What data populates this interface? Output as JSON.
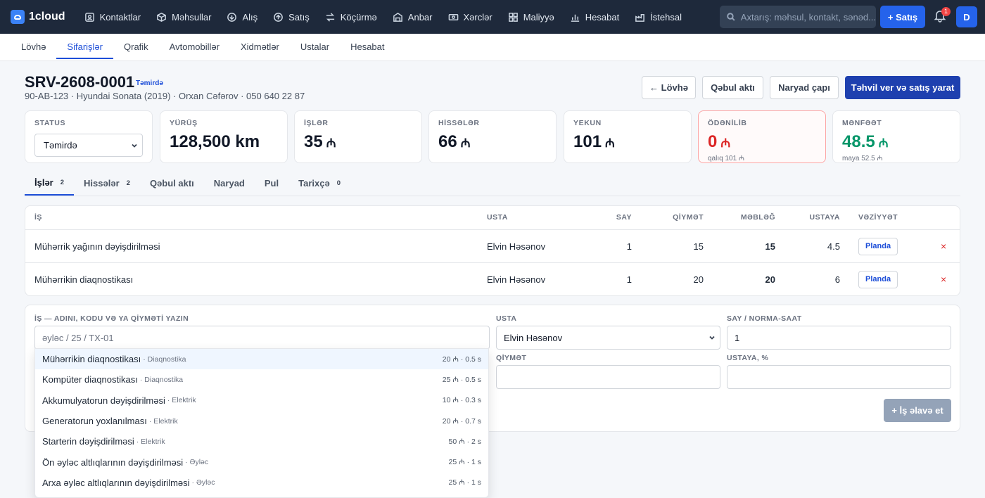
{
  "app": {
    "logo": "1cloud"
  },
  "nav": [
    {
      "label": "Kontaktlar",
      "icon": "contacts-icon"
    },
    {
      "label": "Məhsullar",
      "icon": "products-icon"
    },
    {
      "label": "Alış",
      "icon": "purchase-icon"
    },
    {
      "label": "Satış",
      "icon": "sales-icon"
    },
    {
      "label": "Köçürmə",
      "icon": "transfer-icon"
    },
    {
      "label": "Anbar",
      "icon": "warehouse-icon"
    },
    {
      "label": "Xərclər",
      "icon": "expenses-icon"
    },
    {
      "label": "Maliyyə",
      "icon": "finance-icon"
    },
    {
      "label": "Hesabat",
      "icon": "report-icon"
    },
    {
      "label": "İstehsal",
      "icon": "production-icon"
    }
  ],
  "search": {
    "placeholder": "Axtarış: məhsul, kontakt, sənəd..."
  },
  "topbar": {
    "new_sale": "+ Satış",
    "notifications": "1",
    "avatar": "D"
  },
  "subnav": [
    {
      "label": "Lövhə"
    },
    {
      "label": "Sifarişlər",
      "active": true
    },
    {
      "label": "Qrafik"
    },
    {
      "label": "Avtomobillər"
    },
    {
      "label": "Xidmətlər"
    },
    {
      "label": "Ustalar"
    },
    {
      "label": "Hesabat"
    }
  ],
  "order": {
    "id": "SRV-2608-0001",
    "status_badge": "Təmirdə",
    "details": "90-AB-123 · Hyundai Sonata (2019) · Orxan Cəfərov · 050 640 22 87"
  },
  "actions": {
    "back": "← Lövhə",
    "acceptance": "Qəbul aktı",
    "print_order": "Naryad çapı",
    "deliver": "Təhvil ver və satış yarat"
  },
  "cards": {
    "status": {
      "label": "STATUS",
      "value": "Təmirdə"
    },
    "mileage": {
      "label": "YÜRÜŞ",
      "value": "128,500 km"
    },
    "works": {
      "label": "İŞLƏR",
      "value": "35",
      "currency": "₼"
    },
    "parts": {
      "label": "HİSSƏLƏR",
      "value": "66",
      "currency": "₼"
    },
    "total": {
      "label": "YEKUN",
      "value": "101",
      "currency": "₼"
    },
    "paid": {
      "label": "ÖDƏNİLİB",
      "value": "0",
      "currency": "₼",
      "sub": "qalıq 101 ₼"
    },
    "profit": {
      "label": "MƏNFƏƏT",
      "value": "48.5",
      "currency": "₼",
      "sub": "maya 52.5 ₼"
    }
  },
  "tabs": [
    {
      "label": "İşlər",
      "count": "2",
      "active": true
    },
    {
      "label": "Hissələr",
      "count": "2"
    },
    {
      "label": "Qəbul aktı"
    },
    {
      "label": "Naryad"
    },
    {
      "label": "Pul"
    },
    {
      "label": "Tarixçə",
      "count": "0"
    }
  ],
  "table": {
    "headers": {
      "work": "İŞ",
      "master": "USTA",
      "qty": "SAY",
      "price": "QİYMƏT",
      "amount": "MƏBLƏĞ",
      "master_share": "USTAYA",
      "state": "VƏZİYYƏT"
    },
    "rows": [
      {
        "work": "Mühərrik yağının dəyişdirilməsi",
        "master": "Elvin Həsənov",
        "qty": "1",
        "price": "15",
        "amount": "15",
        "master_share": "4.5",
        "state": "Planda",
        "delete": "×"
      },
      {
        "work": "Mühərrikin diaqnostikası",
        "master": "Elvin Həsənov",
        "qty": "1",
        "price": "20",
        "amount": "20",
        "master_share": "6",
        "state": "Planda",
        "delete": "×"
      }
    ]
  },
  "form": {
    "work_label": "İŞ — ADINI, KODU VƏ YA QİYMƏTİ YAZIN",
    "work_placeholder": "əyləc / 25 / TX-01",
    "master_label": "USTA",
    "master_value": "Elvin Həsənov",
    "qty_label": "SAY / NORMA-SAAT",
    "qty_value": "1",
    "price_label": "QİYMƏT",
    "share_label": "USTAYA, %",
    "add_button": "+ İş əlavə et"
  },
  "suggestions": [
    {
      "name": "Mühərrikin diaqnostikası",
      "category": "· Diaqnostika",
      "meta": "20 ₼ · 0.5 s"
    },
    {
      "name": "Kompüter diaqnostikası",
      "category": "· Diaqnostika",
      "meta": "25 ₼ · 0.5 s"
    },
    {
      "name": "Akkumulyatorun dəyişdirilməsi",
      "category": "· Elektrik",
      "meta": "10 ₼ · 0.3 s"
    },
    {
      "name": "Generatorun yoxlanılması",
      "category": "· Elektrik",
      "meta": "20 ₼ · 0.7 s"
    },
    {
      "name": "Starterin dəyişdirilməsi",
      "category": "· Elektrik",
      "meta": "50 ₼ · 2 s"
    },
    {
      "name": "Ön əyləc altlıqlarının dəyişdirilməsi",
      "category": "· Əyləc",
      "meta": "25 ₼ · 1 s"
    },
    {
      "name": "Arxa əyləc altlıqlarının dəyişdirilməsi",
      "category": "· Əyləc",
      "meta": "25 ₼ · 1 s"
    }
  ]
}
